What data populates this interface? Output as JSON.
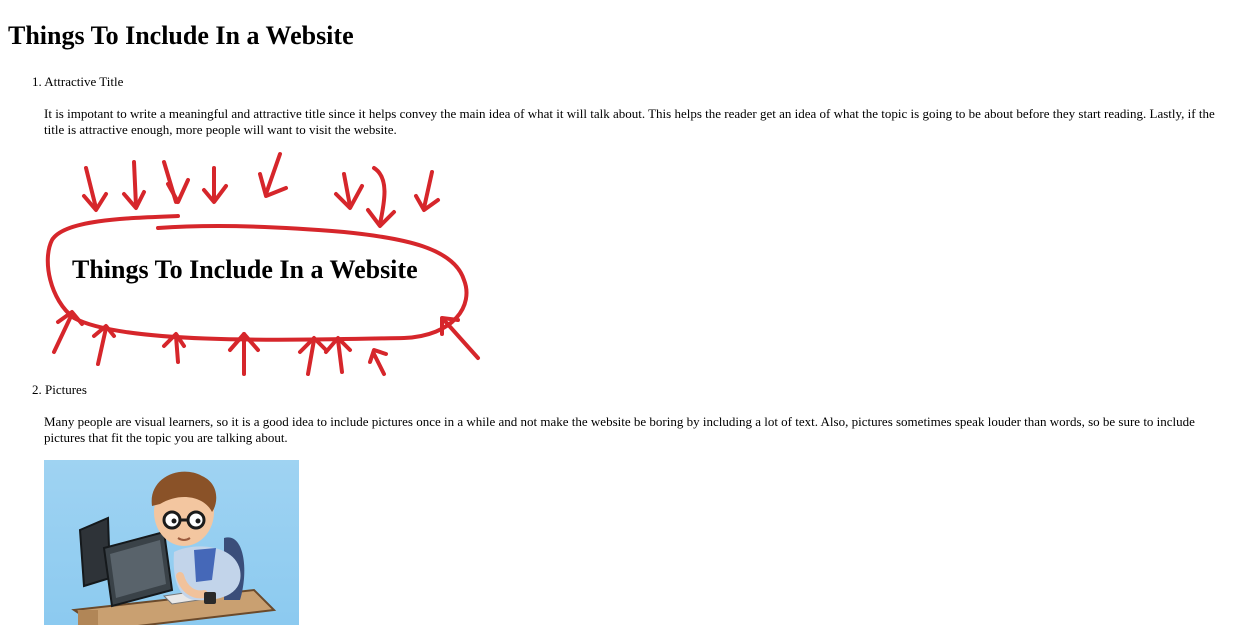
{
  "page": {
    "title": "Things To Include In a Website"
  },
  "items": [
    {
      "number": "1.",
      "heading": "Attractive Title",
      "body": "It is impotant to write a meaningful and attractive title since it helps convey the main idea of what it will talk about. This helps the reader get an idea of what the topic is going to be about before they start reading. Lastly, if the title is attractive enough, more people will want to visit the website.",
      "figure_text": "Things To Include In a Website"
    },
    {
      "number": "2.",
      "heading": "Pictures",
      "body": "Many people are visual learners, so it is a good idea to include pictures once in a while and not make the website be boring by including a lot of text. Also, pictures sometimes speak louder than words, so be sure to include pictures that fit the topic you are talking about."
    }
  ],
  "colors": {
    "annotation_red": "#d6262b",
    "picture_sky": "#9fd3f2"
  },
  "icons": {
    "annotation": "red-hand-drawn-arrows",
    "picture": "boy-at-computer-illustration"
  }
}
